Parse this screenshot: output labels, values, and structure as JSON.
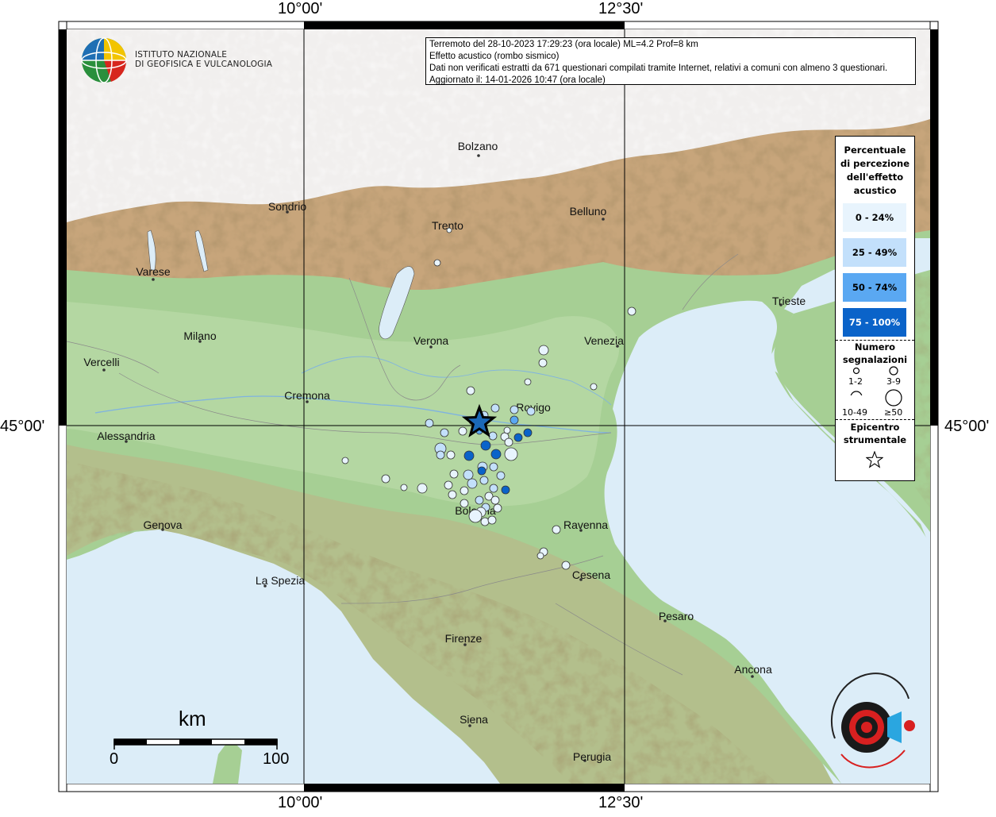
{
  "grid_labels": {
    "top_left": "10°00'",
    "top_right": "12°30'",
    "bottom_left": "10°00'",
    "bottom_right": "12°30'",
    "left_lat": "45°00'",
    "right_lat": "45°00'"
  },
  "info": {
    "line1": "Terremoto del 28-10-2023 17:29:23 (ora locale) ML=4.2 Prof=8 km",
    "line2": "Effetto acustico (rombo sismico)",
    "line3": "Dati non verificati estratti da 671 questionari compilati tramite Internet, relativi a comuni con almeno 3 questionari.",
    "line4": "Aggiornato il: 14-01-2026 10:47 (ora locale)"
  },
  "institute": {
    "line1": "ISTITUTO NAZIONALE",
    "line2": "DI GEOFISICA E VULCANOLOGIA"
  },
  "cities": [
    {
      "name": "Bolzano"
    },
    {
      "name": "Sondrio"
    },
    {
      "name": "Trento"
    },
    {
      "name": "Belluno"
    },
    {
      "name": "Varese"
    },
    {
      "name": "Trieste"
    },
    {
      "name": "Milano"
    },
    {
      "name": "Verona"
    },
    {
      "name": "Venezia"
    },
    {
      "name": "Vercelli"
    },
    {
      "name": "Cremona"
    },
    {
      "name": "Rovigo"
    },
    {
      "name": "Alessandria"
    },
    {
      "name": "Genova"
    },
    {
      "name": "Bologna"
    },
    {
      "name": "Ravenna"
    },
    {
      "name": "La Spezia"
    },
    {
      "name": "Cesena"
    },
    {
      "name": "Pesaro"
    },
    {
      "name": "Firenze"
    },
    {
      "name": "Ancona"
    },
    {
      "name": "Siena"
    },
    {
      "name": "Perugia"
    }
  ],
  "legend": {
    "title": [
      "Percentuale",
      "di percezione",
      "dell'effetto",
      "acustico"
    ],
    "classes": [
      {
        "label": "0 - 24%",
        "color": "#e8f4fd"
      },
      {
        "label": "25 - 49%",
        "color": "#c3e0fb"
      },
      {
        "label": "50 - 74%",
        "color": "#5aa8f2"
      },
      {
        "label": "75 - 100%",
        "color": "#0a63c9"
      }
    ],
    "count_title": [
      "Numero",
      "segnalazioni"
    ],
    "sizes": [
      "1-2",
      "3-9",
      "10-49",
      "≥50"
    ],
    "epicenter_title": [
      "Epicentro",
      "strumentale"
    ]
  },
  "scale": {
    "unit": "km",
    "min": "0",
    "max": "100"
  },
  "epicenter_symbol": "star-icon",
  "colors": {
    "land": "#a6cf94",
    "sea": "#dcedf8",
    "mountain": "#c7a57b",
    "high_mountain": "#f4f4f6"
  }
}
